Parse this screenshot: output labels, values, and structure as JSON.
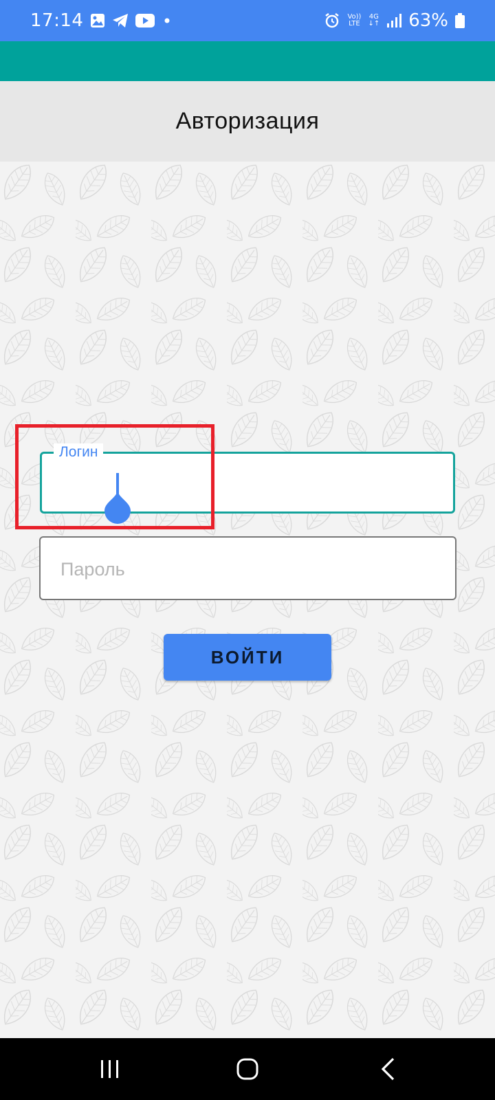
{
  "status_bar": {
    "time": "17:14",
    "battery_percent": "63%",
    "network_label_top": "Vo))",
    "network_label_bottom": "LTE",
    "network_type": "4G",
    "icons_left": [
      "image-icon",
      "telegram-icon",
      "youtube-icon",
      "dot-icon"
    ],
    "icons_right": [
      "alarm-icon",
      "volte-icon",
      "data-4g-icon",
      "signal-icon",
      "battery-icon"
    ]
  },
  "header": {
    "title": "Авторизация"
  },
  "form": {
    "login_label": "Логин",
    "login_value": "",
    "password_placeholder": "Пароль",
    "password_value": "",
    "submit_label": "ВОЙТИ"
  },
  "colors": {
    "status_bar": "#4486f2",
    "app_bar": "#00a29b",
    "header_bg": "#e7e7e7",
    "accent": "#4486f2",
    "focused_border": "#14a39c",
    "annotation": "#e8202a"
  },
  "nav_bar": {
    "buttons": [
      "recents-icon",
      "home-icon",
      "back-icon"
    ]
  }
}
